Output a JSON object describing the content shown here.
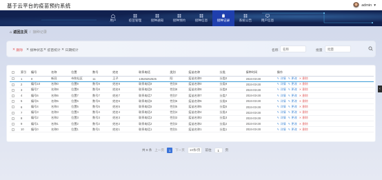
{
  "app": {
    "title": "基于云平台的疫苗预约系统",
    "user": "admin"
  },
  "nav": [
    {
      "label": "用户",
      "icon": "home-icon",
      "active": false
    },
    {
      "label": "疫苗管理",
      "icon": "grid-icon",
      "active": false
    },
    {
      "label": "接种通知",
      "icon": "grid-icon",
      "active": false
    },
    {
      "label": "接种预约",
      "icon": "grid-icon",
      "active": false
    },
    {
      "label": "接种信息",
      "icon": "grid-icon",
      "active": false
    },
    {
      "label": "接种记录",
      "icon": "clipboard-icon",
      "active": true
    },
    {
      "label": "系统公告",
      "icon": "grid-icon",
      "active": false
    },
    {
      "label": "用户信息",
      "icon": "monitor-icon",
      "active": false
    }
  ],
  "breadcrumb": {
    "home": "返回主页",
    "current": "接种记录"
  },
  "toolbar": {
    "delete": "删除",
    "btn2": "接种状态",
    "btn3": "疫苗统计",
    "btn4": "日期统计",
    "field1_label": "名称",
    "field1_placeholder": "名称",
    "field2_label": "批量",
    "field2_placeholder": "批量"
  },
  "table": {
    "headers": [
      "索引",
      "编号",
      "名称",
      "位置",
      "数号",
      "姓名",
      "联系电话",
      "类别",
      "疫苗名称",
      "分类",
      "接种时间",
      "操作"
    ],
    "actions": {
      "view": "详情",
      "edit": "更改",
      "delete": "删除"
    },
    "rows": [
      [
        "1",
        "0",
        "新冠",
        "市和社区",
        "11",
        "王子",
        "13525252525",
        "阳",
        "疫苗名称0",
        "分类0",
        "2024-03-28"
      ],
      [
        "2",
        "编号10",
        "名称0",
        "位置9",
        "数号9",
        "姓名9",
        "联系电话9",
        "性别0",
        "疫苗名称0",
        "分类9",
        "2024-03-28"
      ],
      [
        "3",
        "编号7",
        "名称8",
        "位置8",
        "数号8",
        "姓名8",
        "联系电话8",
        "性别8",
        "疫苗名称8",
        "分类8",
        "2024-03-28"
      ],
      [
        "4",
        "编号6",
        "名称6",
        "位置7",
        "数号7",
        "姓名7",
        "联系电话7",
        "性别7",
        "疫苗名称7",
        "分类7",
        "2024-03-28"
      ],
      [
        "5",
        "编号5",
        "名称5",
        "位置6",
        "数号6",
        "姓名6",
        "联系电话6",
        "性别6",
        "疫苗名称6",
        "分类6",
        "2024-03-28"
      ],
      [
        "6",
        "编号4",
        "名称4",
        "位置5",
        "数号5",
        "姓名5",
        "联系电话5",
        "性别5",
        "疫苗名称5",
        "分类5",
        "2024-03-28"
      ],
      [
        "7",
        "编号3",
        "名称3",
        "位置4",
        "数号4",
        "姓名4",
        "联系电话4",
        "性别4",
        "疫苗名称4",
        "分类4",
        "2024-03-28"
      ],
      [
        "8",
        "编号2",
        "名称2",
        "位置3",
        "数号3",
        "姓名3",
        "联系电话3",
        "性别3",
        "疫苗名称3",
        "分类3",
        "2024-03-28"
      ],
      [
        "9",
        "编号1",
        "名称1",
        "位置2",
        "数号2",
        "姓名2",
        "联系电话2",
        "性别2",
        "疫苗名称2",
        "分类2",
        "2024-03-28"
      ],
      [
        "10",
        "编号0",
        "名称0",
        "位置1",
        "数号1",
        "姓名1",
        "联系电话1",
        "性别1",
        "疫苗名称1",
        "分类1",
        "2024-03-28"
      ]
    ]
  },
  "pager": {
    "total": "共 9 条",
    "prev": "上一页",
    "page": "1",
    "next": "下一页",
    "size": "10条/页",
    "goto": "前往",
    "goto_value": "1",
    "goto_suffix": "页"
  },
  "colors": {
    "nav_bg": "#11214f",
    "nav_active": "#1f3fae",
    "accent": "#3a73d9",
    "danger": "#e06666"
  }
}
